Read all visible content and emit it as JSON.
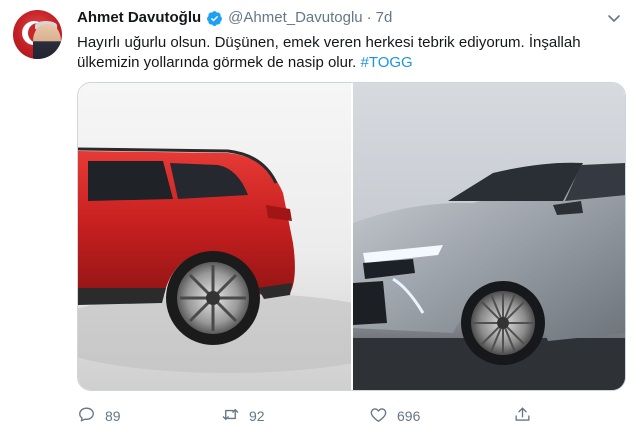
{
  "tweet": {
    "author_name": "Ahmet Davutoğlu",
    "handle": "@Ahmet_Davutoglu",
    "separator": "·",
    "time": "7d",
    "text_main": "Hayırlı uğurlu olsun. Düşünen, emek veren herkesi tebrik ediyorum. İnşallah ülkemizin yollarında görmek de nasip olur. ",
    "hashtag": "#TOGG",
    "verified_icon": "verified-badge-icon",
    "caret_icon": "chevron-down-icon"
  },
  "media": {
    "images": [
      "red-suv-rear-photo",
      "silver-sedan-front-photo"
    ]
  },
  "actions": {
    "reply_count": "89",
    "retweet_count": "92",
    "like_count": "696",
    "icons": [
      "reply-icon",
      "retweet-icon",
      "like-icon",
      "share-icon"
    ]
  },
  "colors": {
    "link": "#1b95e0",
    "secondary": "#657786",
    "verified": "#1da1f2"
  }
}
